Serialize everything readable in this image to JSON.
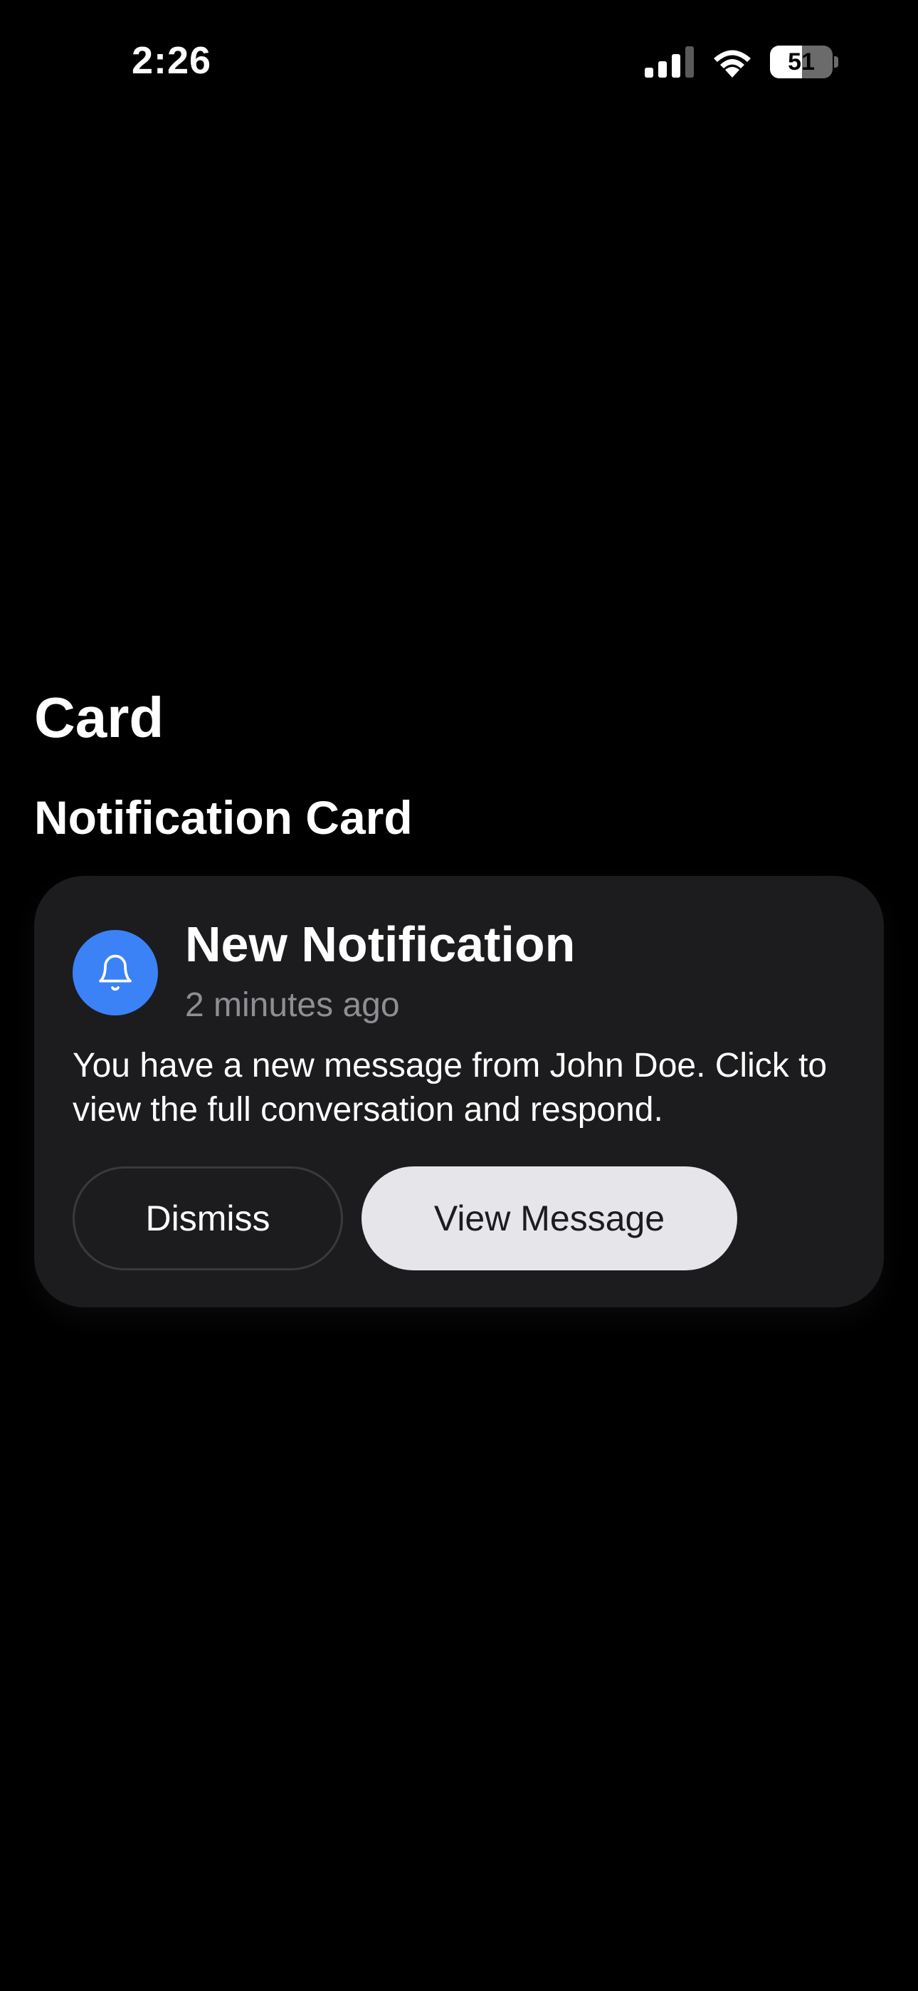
{
  "status_bar": {
    "time": "2:26",
    "battery_level": 51,
    "battery_label": "51",
    "signal_icon": "cellular-signal-icon",
    "wifi_icon": "wifi-icon"
  },
  "page": {
    "title": "Card",
    "section_title": "Notification Card"
  },
  "card": {
    "icon": "bell-icon",
    "icon_bg_color": "#3b82f6",
    "title": "New Notification",
    "timestamp": "2 minutes ago",
    "body": "You have a new message from John Doe. Click to view the full conversation and respond.",
    "dismiss_label": "Dismiss",
    "view_label": "View Message"
  },
  "colors": {
    "background": "#000000",
    "card_background": "#1c1c1e",
    "accent": "#3b82f6",
    "secondary_text": "#8e8e93",
    "primary_button_bg": "#e5e5ea"
  }
}
